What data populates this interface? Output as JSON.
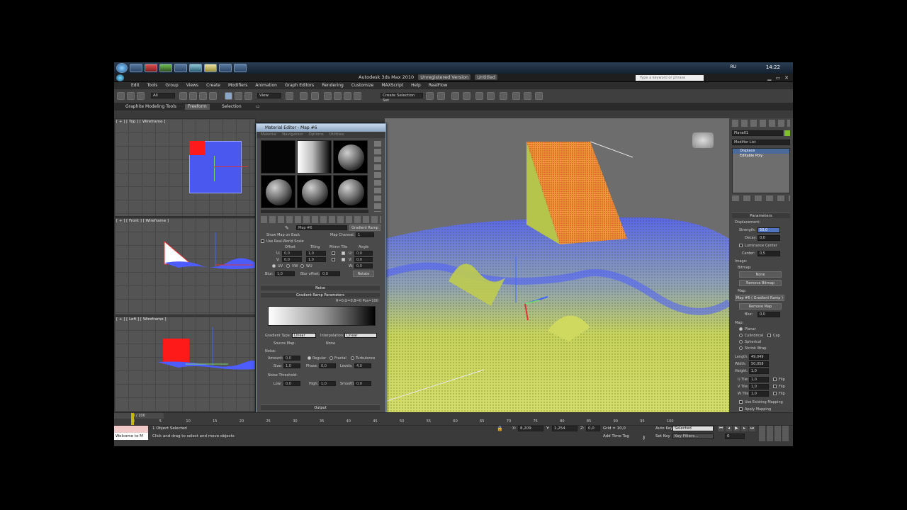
{
  "taskbar": {
    "lang": "RU",
    "clock": "14:22"
  },
  "window": {
    "title": "Autodesk 3ds Max 2010",
    "title_tag": "Unregistered Version",
    "title_file": "Untitled",
    "search_placeholder": "Type a keyword or phrase"
  },
  "menubar": {
    "items": [
      "Edit",
      "Tools",
      "Group",
      "Views",
      "Create",
      "Modifiers",
      "Animation",
      "Graph Editors",
      "Rendering",
      "Customize",
      "MAXScript",
      "Help",
      "RealFlow"
    ]
  },
  "toolbar": {
    "selection_filter": "All",
    "ref_coord": "View",
    "named_selection": "Create Selection Set"
  },
  "ribbon": {
    "title": "Graphite Modeling Tools",
    "tabs": [
      "Freeform",
      "Selection"
    ]
  },
  "viewports": {
    "top": "[ + ] [ Top ] [ Wireframe ]",
    "front": "[ + ] [ Front ] [ Wireframe ]",
    "left": "[ + ] [ Left ] [ Wireframe ]"
  },
  "material_editor": {
    "title": "Material Editor - Map #6",
    "menu": [
      "Material",
      "Navigation",
      "Options",
      "Utilities"
    ],
    "map_name": "Map #6",
    "map_type": "Gradient Ramp",
    "show_map": "Show Map on Back",
    "map_channel_label": "Map Channel:",
    "map_channel": "1",
    "use_real_world": "Use Real-World Scale",
    "offset_label": "Offset",
    "tiling_label": "Tiling",
    "mirror_tile_label": "Mirror Tile",
    "angle_label": "Angle",
    "u_label": "U:",
    "v_label": "V:",
    "w_label": "W:",
    "u_offset": "0,0",
    "v_offset": "0,0",
    "u_tiling": "1,0",
    "v_tiling": "1,0",
    "u_angle": "0,0",
    "v_angle": "0,0",
    "w_angle": "0,0",
    "uv": "UV",
    "vw": "VW",
    "wu": "WU",
    "blur_label": "Blur:",
    "blur": "1,0",
    "blur_offset_label": "Blur offset:",
    "blur_offset": "0,0",
    "rotate": "Rotate",
    "rollout_noise": "Noise",
    "rollout_gradient": "Gradient Ramp Parameters",
    "rgb_readout": "R=0,G=0,B=0  Pos=100",
    "gradient_type_label": "Gradient Type:",
    "gradient_type": "Linear",
    "interpolation_label": "Interpolation:",
    "interpolation": "Linear",
    "source_map_label": "Source Map:",
    "source_map": "None",
    "noise_group": "Noise:",
    "amount_label": "Amount:",
    "amount": "0,0",
    "regular": "Regular",
    "fractal": "Fractal",
    "turbulence": "Turbulence",
    "size_label": "Size:",
    "size": "1,0",
    "phase_label": "Phase:",
    "phase": "0,0",
    "levels_label": "Levels:",
    "levels": "4,0",
    "noise_threshold": "Noise Threshold:",
    "low_label": "Low:",
    "low": "0,0",
    "high_label": "High:",
    "high": "1,0",
    "smooth_label": "Smooth:",
    "smooth": "0,0",
    "rollout_output": "Output"
  },
  "command_panel": {
    "object_name": "Plane01",
    "modifier_list": "Modifier List",
    "stack": [
      "Displace",
      "Editable Poly"
    ],
    "parameters": "Parameters",
    "displacement": "Displacement:",
    "strength_label": "Strength:",
    "strength": "50,0",
    "decay_label": "Decay:",
    "decay": "0,0",
    "luminance_center": "Luminance Center",
    "center_label": "Center:",
    "center": "0,5",
    "image_label": "Image:",
    "bitmap_label": "Bitmap:",
    "bitmap_btn": "None",
    "remove_bitmap": "Remove Bitmap",
    "map_label": "Map:",
    "map_btn": "Map #6 ( Gradient Ramp )",
    "remove_map": "Remove Map",
    "blur_label": "Blur:",
    "blur": "0,0",
    "map_group": "Map:",
    "planar": "Planar",
    "cylindrical": "Cylindrical",
    "cap": "Cap",
    "spherical": "Spherical",
    "shrink_wrap": "Shrink Wrap",
    "length_label": "Length:",
    "length": "49,049",
    "width_label": "Width:",
    "width": "50,058",
    "height_label": "Height:",
    "height": "1,0",
    "u_tile_label": "U Tile:",
    "u_tile": "1,0",
    "v_tile_label": "V Tile:",
    "v_tile": "1,0",
    "w_tile_label": "W Tile:",
    "w_tile": "1,0",
    "flip": "Flip",
    "use_existing_mapping": "Use Existing Mapping",
    "apply_mapping": "Apply Mapping"
  },
  "timeline": {
    "frame_counter": "0 / 100",
    "ticks": [
      "0",
      "5",
      "10",
      "15",
      "20",
      "25",
      "30",
      "35",
      "40",
      "45",
      "50",
      "55",
      "60",
      "65",
      "70",
      "75",
      "80",
      "85",
      "90",
      "95",
      "100"
    ]
  },
  "status": {
    "script_listener": "Welcome to M",
    "selected": "1 Object Selected",
    "prompt": "Click and drag to select and move objects",
    "x_label": "X:",
    "x": "8,209",
    "y_label": "Y:",
    "y": "1,254",
    "z_label": "Z:",
    "z": "0,0",
    "grid": "Grid = 10,0",
    "add_time_tag": "Add Time Tag",
    "auto_key": "Auto Key",
    "auto_key_sel": "Selected",
    "set_key": "Set Key",
    "key_filters": "Key Filters...",
    "frame": "0"
  },
  "colors": {
    "accent": "#7ad8ff",
    "ui_bg": "#3a3a3a",
    "terrain": "#c7d45a",
    "wire": "#4d5cff",
    "ramp": "#ea7b2e"
  }
}
